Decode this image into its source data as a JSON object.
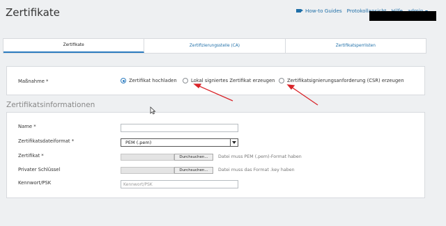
{
  "header": {
    "title": "Zertifikate",
    "nav": {
      "howto": "How-to Guides",
      "protokoll": "Protokollansicht",
      "hilfe": "Hilfe",
      "admin": "admin"
    }
  },
  "tabs": [
    {
      "label": "Zertifikate",
      "active": true
    },
    {
      "label": "Zertifizierungsstelle (CA)",
      "active": false
    },
    {
      "label": "Zertifikatsperrlisten",
      "active": false
    }
  ],
  "massnahme": {
    "label": "Maßnahme *",
    "options": [
      {
        "label": "Zertifikat hochladen",
        "checked": true
      },
      {
        "label": "Lokal signiertes Zertifikat erzeugen",
        "checked": false
      },
      {
        "label": "Zertifikatsignierungsanforderung (CSR) erzeugen",
        "checked": false
      }
    ]
  },
  "info": {
    "section_title": "Zertifikatsinformationen",
    "name_label": "Name *",
    "name_value": "",
    "format_label": "Zertifikatsdateiformat *",
    "format_value": "PEM (.pem)",
    "cert_label": "Zertifikat *",
    "cert_browse": "Durchsuchen...",
    "cert_hint": "Datei muss PEM (.pem)-Format haben",
    "key_label": "Privater Schlüssel",
    "key_browse": "Durchsuchen...",
    "key_hint": "Datei muss das Format .key haben",
    "psk_label": "Kennwort/PSK",
    "psk_placeholder": "Kennwort/PSK"
  },
  "colors": {
    "accent": "#2b7bbf",
    "annotation": "#d9252a"
  }
}
